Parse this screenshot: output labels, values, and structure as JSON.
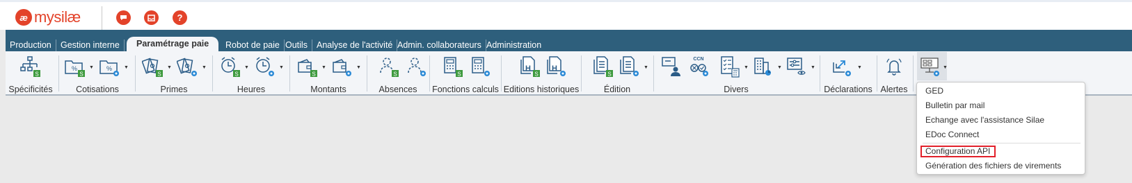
{
  "app": {
    "logo_mark": "æ",
    "logo_text": "mysilæ"
  },
  "top_buttons": [
    {
      "name": "chat-icon",
      "glyph": "▬"
    },
    {
      "name": "inbox-icon",
      "glyph": "▭"
    },
    {
      "name": "help-icon",
      "glyph": "?"
    }
  ],
  "nav": {
    "tabs": [
      "Production",
      "Gestion interne",
      "Paramétrage paie",
      "Robot de paie",
      "Outils",
      "Analyse de l'activité",
      "Admin. collaborateurs",
      "Administration"
    ],
    "active": "Paramétrage paie"
  },
  "ribbon": {
    "groups": [
      "Spécificités",
      "Cotisations",
      "Primes",
      "Heures",
      "Montants",
      "Absences",
      "Fonctions calculs",
      "Editions historiques",
      "Édition",
      "Divers",
      "Déclarations",
      "Alertes"
    ],
    "badge_text": "S",
    "ccn_label": "CCN",
    "h_label": "H"
  },
  "dropdown": {
    "items": [
      "GED",
      "Bulletin par mail",
      "Echange avec l'assistance Silae",
      "EDoc Connect",
      "Configuration API",
      "Génération des fichiers de virements"
    ],
    "highlighted": "Configuration API"
  },
  "colors": {
    "brand": "#e3432a",
    "nav": "#2e5f7c",
    "icon": "#2b5c87",
    "badge": "#3e9a3e",
    "highlight_border": "#e2202a"
  }
}
